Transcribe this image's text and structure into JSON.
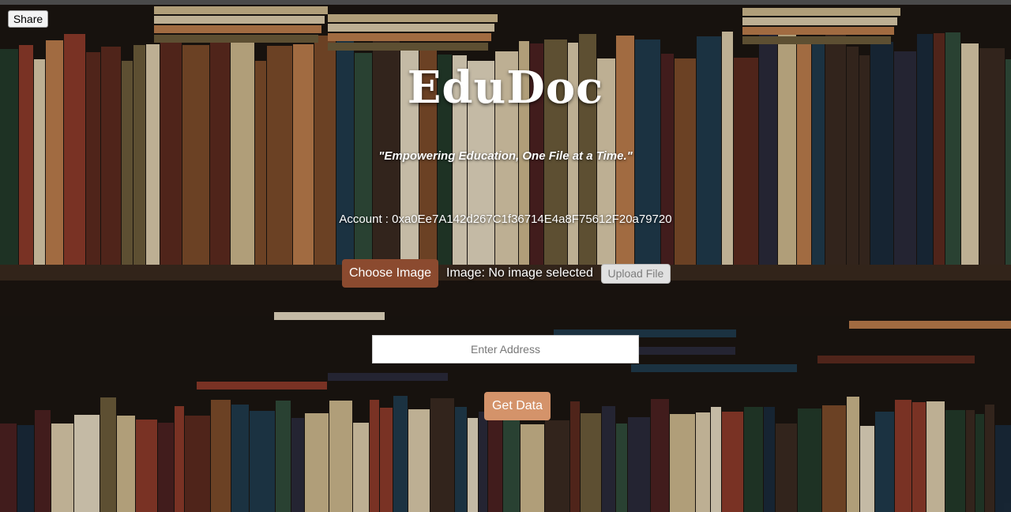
{
  "toolbar": {
    "share_label": "Share"
  },
  "header": {
    "title": "EduDoc",
    "tagline": "\"Empowering Education, One File at a Time.\""
  },
  "account": {
    "text": "Account : 0xa0Ee7A142d267C1f36714E4a8F75612F20a79720"
  },
  "upload": {
    "choose_label": "Choose Image",
    "status_text": "Image: No image selected",
    "upload_label": "Upload File"
  },
  "lookup": {
    "address_placeholder": "Enter Address",
    "get_label": "Get Data"
  },
  "colors": {
    "choose_button": "#8b4a2f",
    "get_button": "#d4936a",
    "text": "#ffffff"
  }
}
